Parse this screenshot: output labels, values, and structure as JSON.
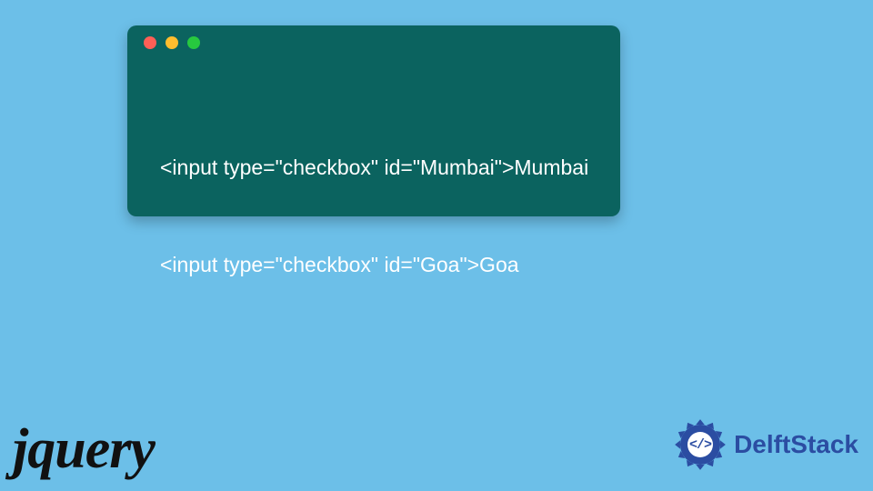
{
  "code": {
    "lines": [
      "<input type=\"checkbox\" id=\"Mumbai\">Mumbai",
      "<input type=\"checkbox\" id=\"Goa\">Goa"
    ]
  },
  "logos": {
    "jquery": "jQuery",
    "delftstack": {
      "name": "DelftStack",
      "symbol": "</>"
    }
  },
  "window": {
    "controls": [
      "close",
      "minimize",
      "zoom"
    ]
  }
}
